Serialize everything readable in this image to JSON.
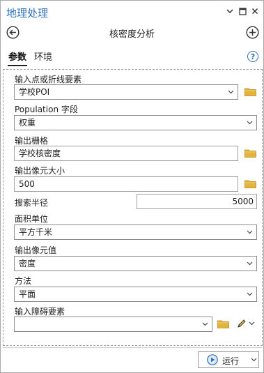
{
  "titlebar": {
    "title": "地理处理",
    "menu_icon": "chevron-down-icon",
    "restore_icon": "maximize-icon",
    "close_icon": "close-icon"
  },
  "tool": {
    "title": "核密度分析",
    "back_icon": "back-arrow-icon",
    "add_icon": "add-icon"
  },
  "tabs": {
    "parameters": "参数",
    "environments": "环境",
    "help_icon": "help-icon",
    "help_label": "?"
  },
  "form": {
    "input_features_label": "输入点或折线要素",
    "input_features_value": "学校POI",
    "population_label": "Population 字段",
    "population_value": "权重",
    "output_raster_label": "输出栅格",
    "output_raster_value": "学校核密度",
    "cell_size_label": "输出像元大小",
    "cell_size_value": "500",
    "search_radius_label": "搜索半径",
    "search_radius_value": "5000",
    "area_units_label": "面积单位",
    "area_units_value": "平方千米",
    "output_values_label": "输出像元值",
    "output_values_value": "密度",
    "method_label": "方法",
    "method_value": "平面",
    "barriers_label": "输入障碍要素",
    "barriers_value": ""
  },
  "footer": {
    "run_label": "运行"
  },
  "colors": {
    "accent": "#2d6fba",
    "folder": "#e3b33a"
  }
}
